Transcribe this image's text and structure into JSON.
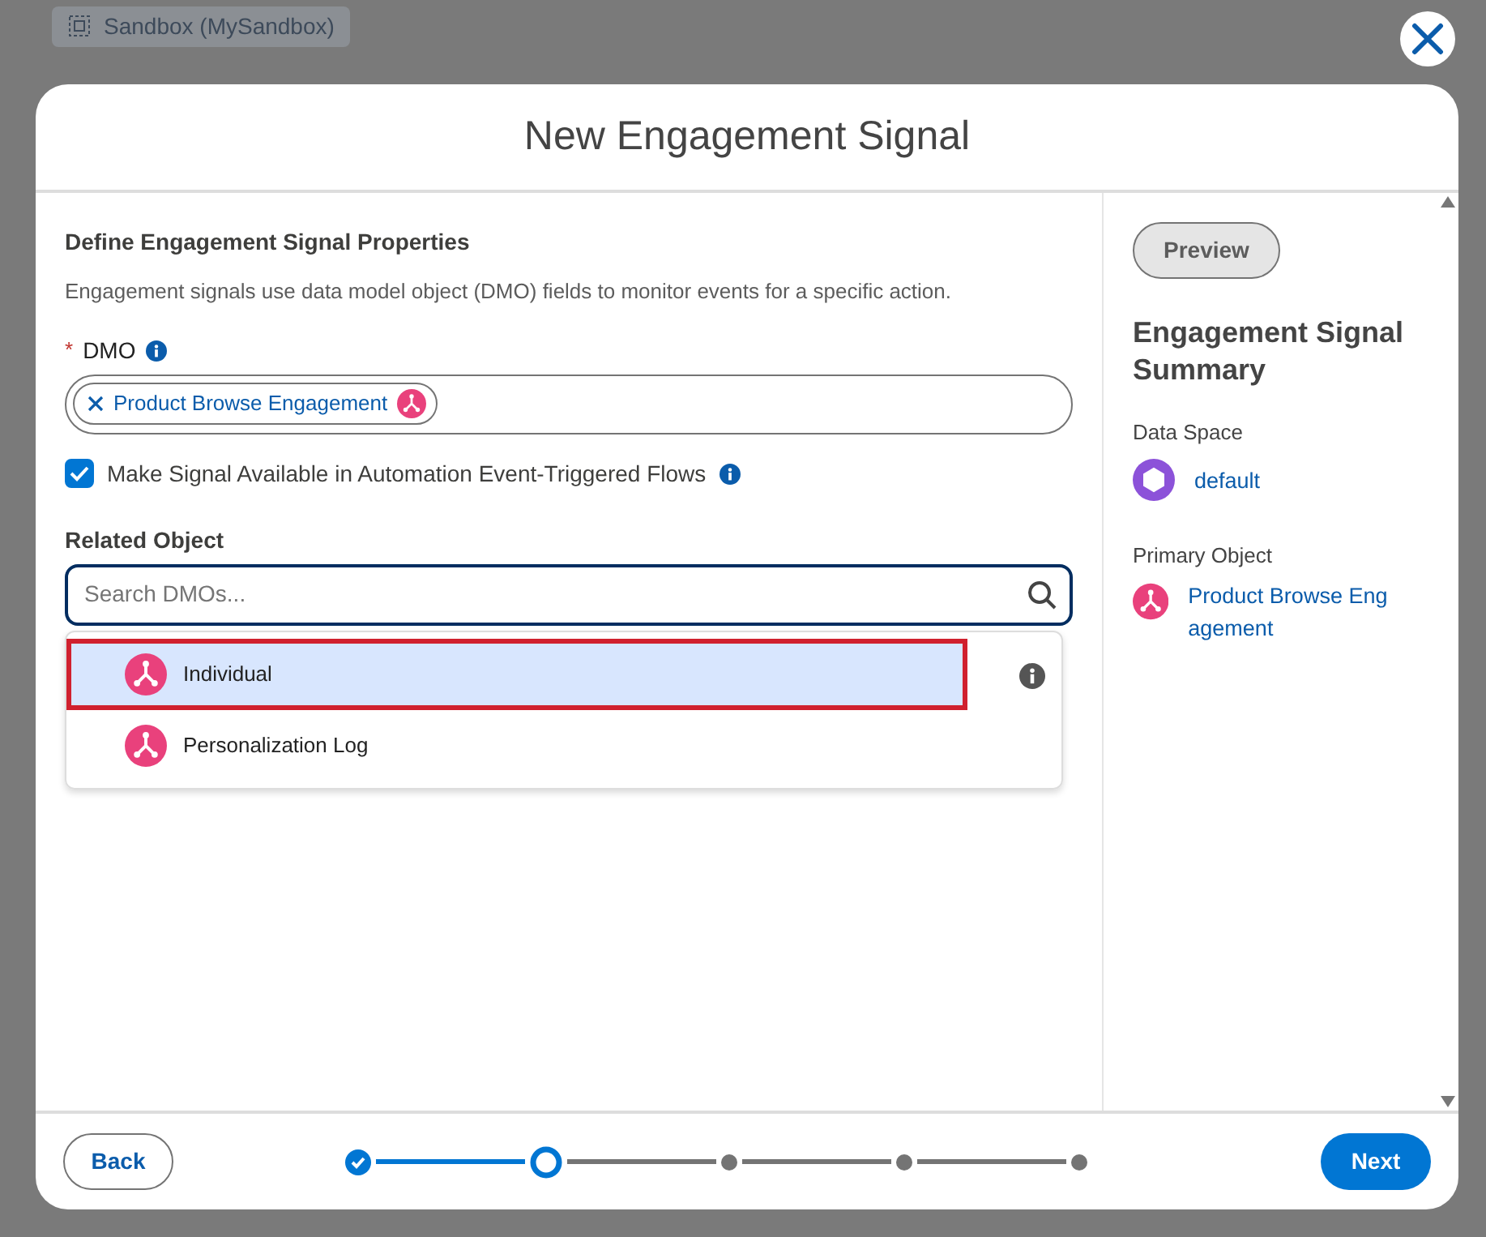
{
  "background": {
    "org_label": "Sandbox (MySandbox)"
  },
  "modal": {
    "title": "New Engagement Signal"
  },
  "form": {
    "section_title": "Define Engagement Signal Properties",
    "description": "Engagement signals use data model object (DMO) fields to monitor events for a specific action.",
    "dmo": {
      "required_mark": "*",
      "label": "DMO",
      "pill": "Product Browse Engagement"
    },
    "automation": {
      "label": "Make Signal Available in Automation Event-Triggered Flows",
      "checked": true
    },
    "related": {
      "label": "Related Object",
      "placeholder": "Search DMOs...",
      "options": [
        {
          "label": "Individual",
          "selected": true,
          "highlighted": true
        },
        {
          "label": "Personalization Log",
          "selected": false,
          "highlighted": false
        }
      ]
    }
  },
  "summary": {
    "preview": "Preview",
    "title": "Engagement Signal Summary",
    "items": [
      {
        "label": "Data Space",
        "value": "default",
        "kind": "space"
      },
      {
        "label": "Primary Object",
        "value": "Product Browse Eng agement",
        "kind": "object"
      }
    ]
  },
  "footer": {
    "back": "Back",
    "next": "Next",
    "steps": [
      {
        "complete": true,
        "current": false
      },
      {
        "complete": false,
        "current": true
      },
      {
        "complete": false,
        "current": false
      },
      {
        "complete": false,
        "current": false
      },
      {
        "complete": false,
        "current": false
      }
    ]
  }
}
